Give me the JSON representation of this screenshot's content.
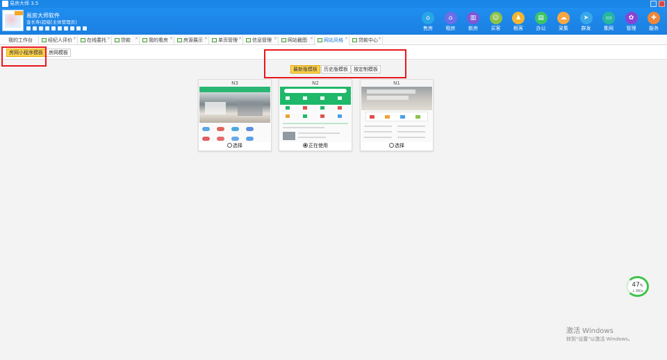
{
  "window": {
    "title": "易房大师 3.5",
    "controls": [
      "maximize",
      "close"
    ]
  },
  "header": {
    "company": "易房大师软件",
    "account": "金长寿(超级[主体管理员]",
    "nav": [
      {
        "label": "售房",
        "icon": "house-icon",
        "color": "#28a5e8"
      },
      {
        "label": "租房",
        "icon": "home-key-icon",
        "color": "#6b6ee8"
      },
      {
        "label": "新房",
        "icon": "building-icon",
        "color": "#7b59d9"
      },
      {
        "label": "买客",
        "icon": "buyer-icon",
        "color": "#8bc34a"
      },
      {
        "label": "租客",
        "icon": "tenant-icon",
        "color": "#f2b632"
      },
      {
        "label": "办公",
        "icon": "printer-icon",
        "color": "#3cc468"
      },
      {
        "label": "采集",
        "icon": "cloud-icon",
        "color": "#f6a743"
      },
      {
        "label": "群发",
        "icon": "send-icon",
        "color": "#39a7e9"
      },
      {
        "label": "集网",
        "icon": "monitor-icon",
        "color": "#27b6a0"
      },
      {
        "label": "管理",
        "icon": "gear-icon",
        "color": "#8a43d6"
      },
      {
        "label": "服务",
        "icon": "service-icon",
        "color": "#f0863a"
      }
    ]
  },
  "tabs": [
    {
      "label": "我的工作台",
      "closable": false
    },
    {
      "label": "经纪人评价",
      "closable": true
    },
    {
      "label": "在线委托",
      "closable": true
    },
    {
      "label": "贷款",
      "closable": true
    },
    {
      "label": "我的看房",
      "closable": true
    },
    {
      "label": "房源展示",
      "closable": true
    },
    {
      "label": "单页管理",
      "closable": true
    },
    {
      "label": "信息管理",
      "closable": true
    },
    {
      "label": "网站截图",
      "closable": true
    },
    {
      "label": "网站风格",
      "closable": true,
      "active": true
    },
    {
      "label": "贷款中心",
      "closable": true
    }
  ],
  "subtabs": [
    {
      "label": "房网小程序模板",
      "active": true
    },
    {
      "label": "房网模板",
      "active": false
    }
  ],
  "template_filters": [
    {
      "label": "最新版模板",
      "active": true
    },
    {
      "label": "历史版模板",
      "active": false
    },
    {
      "label": "按定制模板",
      "active": false
    }
  ],
  "templates": [
    {
      "code": "N3",
      "status": "选择",
      "selected": false
    },
    {
      "code": "N2",
      "status": "正在使用",
      "selected": true
    },
    {
      "code": "N1",
      "status": "选择",
      "selected": false
    }
  ],
  "speed_widget": {
    "percent": "47",
    "unit": "%",
    "speed": "0K/s",
    "arrow": "↓"
  },
  "activation": {
    "title": "激活 Windows",
    "subtitle": "转到\"设置\"以激活 Windows。"
  },
  "colors": {
    "brand_blue": "#1b82e6",
    "accent_yellow": "#ffd34d",
    "highlight_red": "#e8151b",
    "template_green": "#1fb86a"
  }
}
